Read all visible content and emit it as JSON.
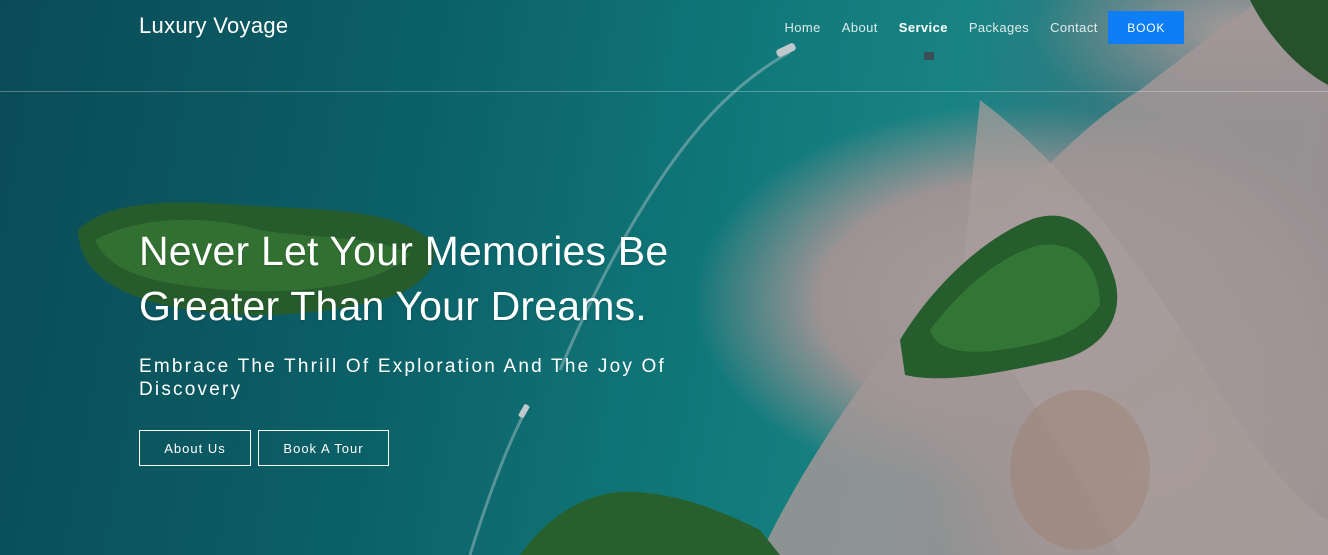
{
  "brand": {
    "name": "Luxury Voyage"
  },
  "nav": {
    "items": [
      {
        "label": "Home",
        "active": false
      },
      {
        "label": "About",
        "active": false
      },
      {
        "label": "Service",
        "active": true
      },
      {
        "label": "Packages",
        "active": false
      },
      {
        "label": "Contact",
        "active": false
      }
    ],
    "book_label": "BOOK"
  },
  "hero": {
    "headline_line1": "Never Let Your Memories Be",
    "headline_line2": "Greater Than Your Dreams.",
    "subheadline": "Embrace The Thrill Of Exploration And The Joy Of Discovery",
    "cta_about": "About Us",
    "cta_tour": "Book A Tour",
    "background_image": "aerial-tropical-islands-photo"
  },
  "colors": {
    "accent": "#0d7ef5",
    "text": "#ffffff",
    "water": "#138e8b",
    "sand": "#c9b9b4",
    "foliage": "#2f6e2a"
  }
}
